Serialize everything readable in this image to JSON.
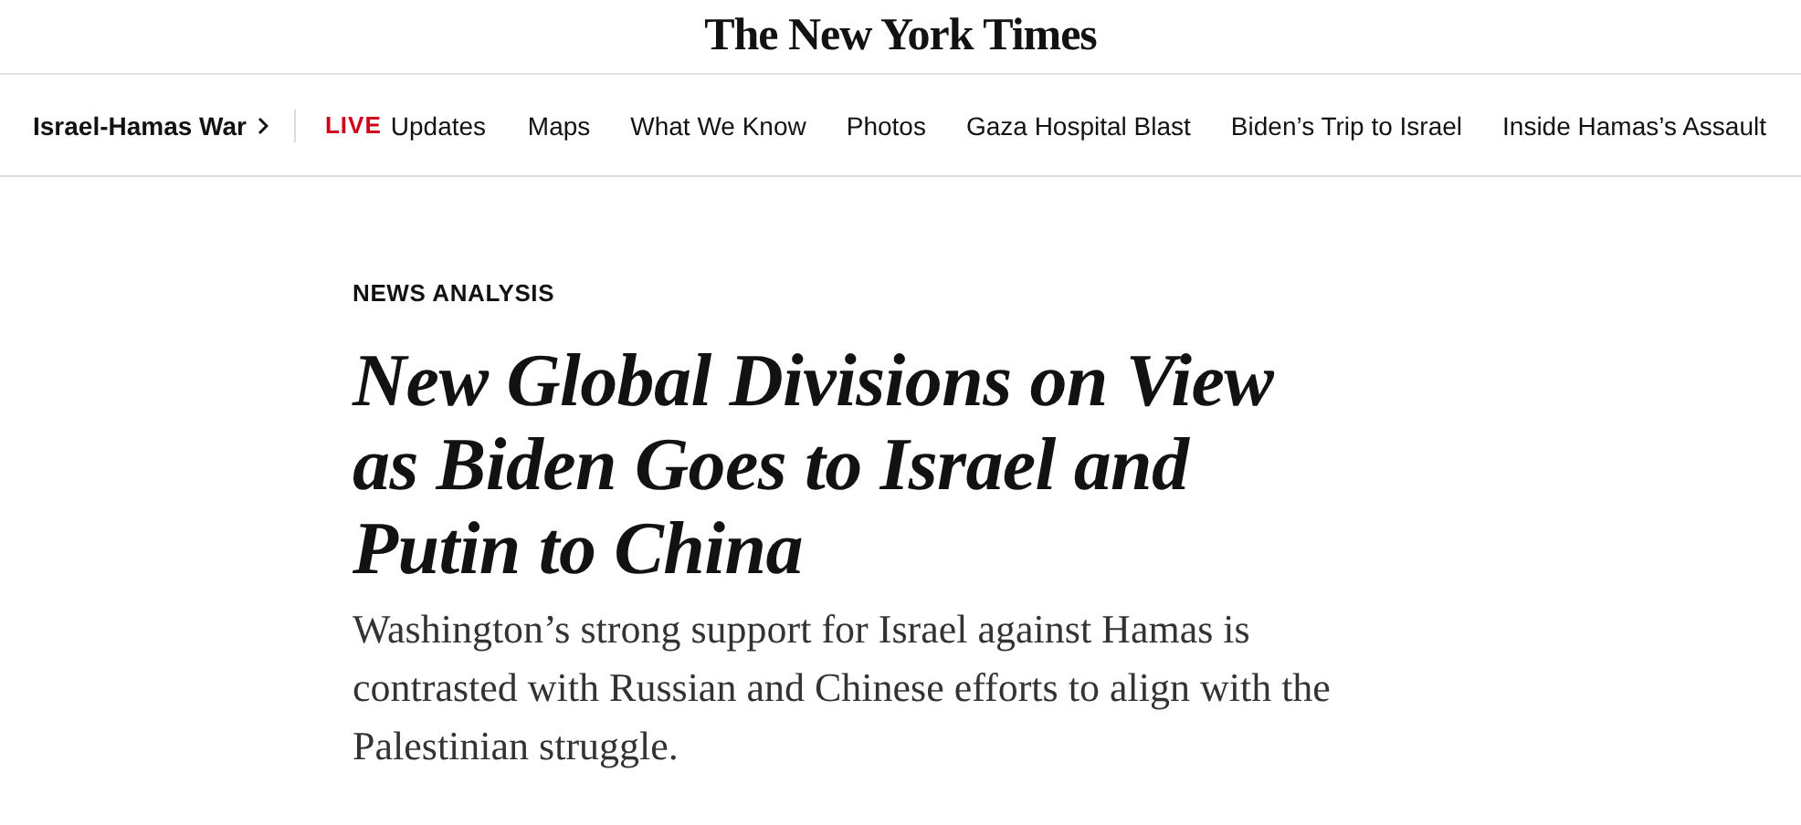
{
  "masthead": {
    "logo": "The New York Times"
  },
  "nav": {
    "section": "Israel-Hamas War",
    "live_label": "LIVE",
    "live_text": "Updates",
    "links": [
      "Maps",
      "What We Know",
      "Photos",
      "Gaza Hospital Blast",
      "Biden’s Trip to Israel",
      "Inside Hamas’s Assault"
    ]
  },
  "article": {
    "kicker": "NEWS ANALYSIS",
    "headline": "New Global Divisions on View as Biden Goes to Israel and Putin to China",
    "summary": "Washington’s strong support for Israel against Hamas is contrasted with Russian and Chinese efforts to align with the Palestinian struggle."
  }
}
